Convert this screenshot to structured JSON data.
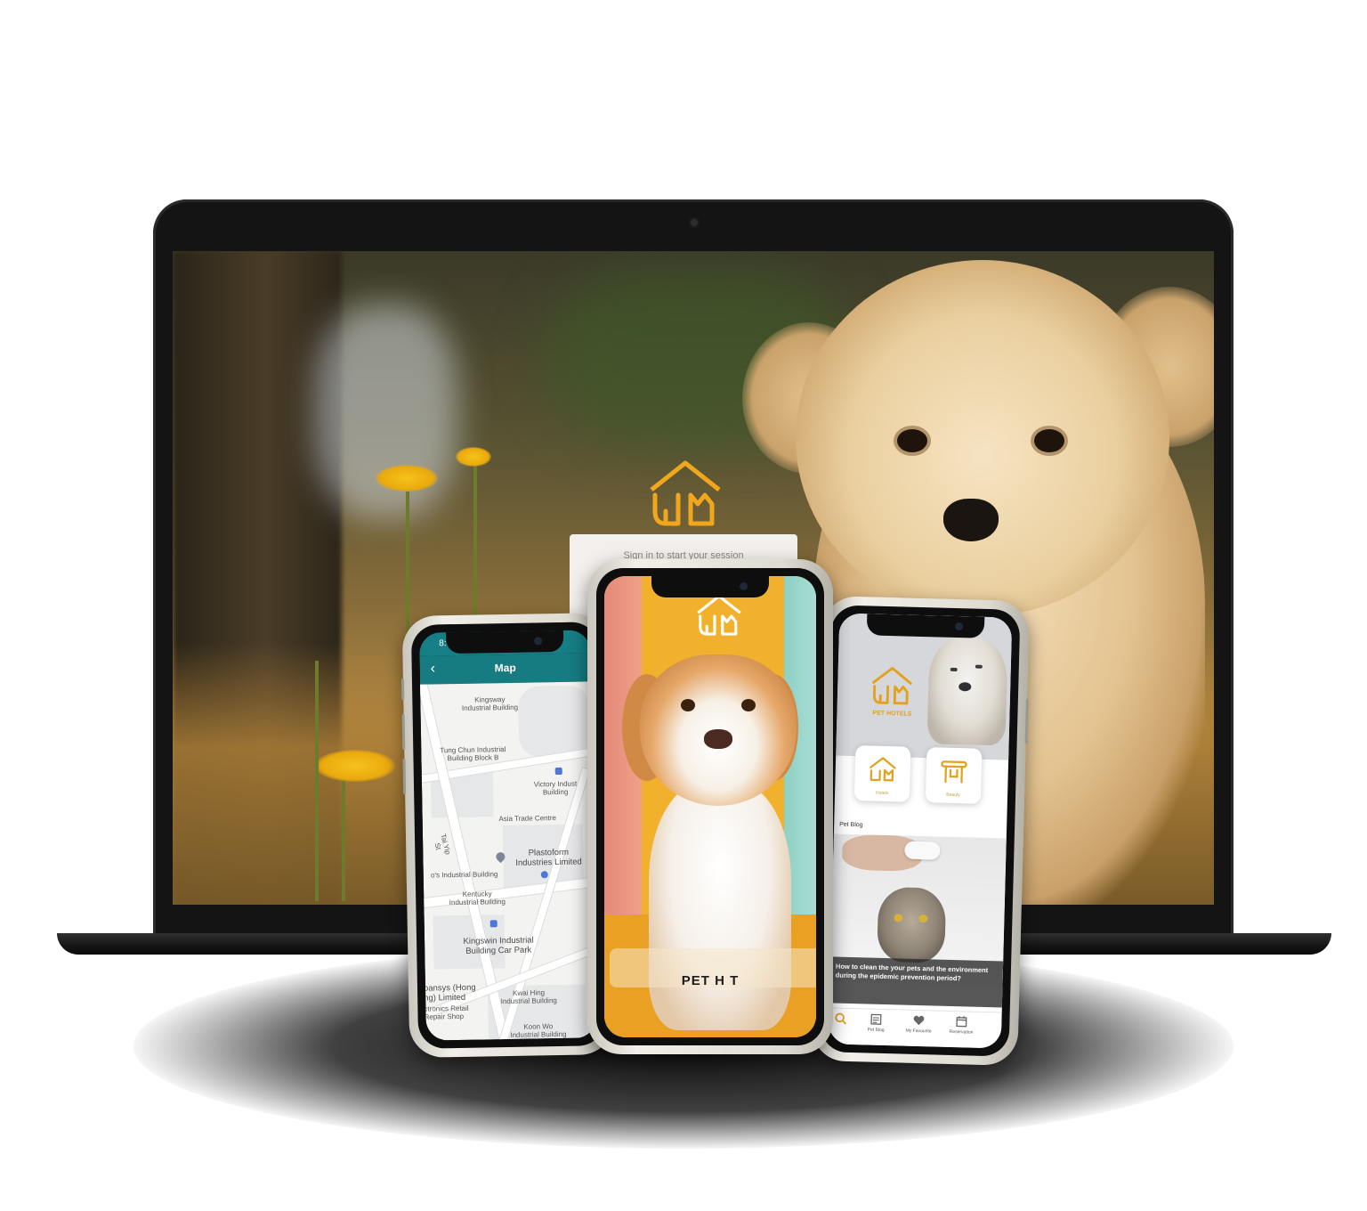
{
  "laptop": {
    "login_prompt": "Sign in to start your session"
  },
  "map_phone": {
    "status_time": "8:08",
    "back_icon": "chevron-left-icon",
    "title": "Map",
    "labels": {
      "kingsway": "Kingsway\nIndustrial Building",
      "tung_chun": "Tung Chun Industrial\nBuilding Block B",
      "victory": "Victory Indust\nBuilding",
      "tai_yip": "Tai Yip St",
      "asia_trade": "Asia Trade Centre",
      "plastoform": "Plastoform\nIndustries Limited",
      "industrial_bldg": "o's Industrial Building",
      "kentucky": "Kentucky\nIndustrial Building",
      "kingswin": "Kingswin Industrial\nBuilding Car Park",
      "pansys": "pansys (Hong\nng) Limited",
      "electronics": "ctronics Retail\nRepair Shop",
      "kwai_hing": "Kwai Hing\nIndustrial Building",
      "koon_wo": "Koon Wo\nIndustrial Building"
    }
  },
  "center_phone": {
    "logo_icon": "pet-hotel-logo-icon",
    "brand_partial": "PET H   T"
  },
  "right_phone": {
    "logo_text": "PET HOTELS",
    "cards": [
      {
        "label": "Hotels",
        "icon": "hotel-icon"
      },
      {
        "label": "Beauty",
        "icon": "grooming-icon"
      }
    ],
    "section_title": "Pet Blog",
    "blog_caption": "How to clean the your pets and the environment during the epidemic prevention period?",
    "nav": [
      {
        "label": "",
        "icon": "search-icon"
      },
      {
        "label": "Pet Blog",
        "icon": "blog-icon"
      },
      {
        "label": "My Favourite",
        "icon": "heart-icon"
      },
      {
        "label": "Reservation",
        "icon": "calendar-icon"
      }
    ]
  },
  "colors": {
    "brand_orange": "#f2b12c",
    "map_teal": "#157f85",
    "logo_gold": "#e2a11e"
  }
}
